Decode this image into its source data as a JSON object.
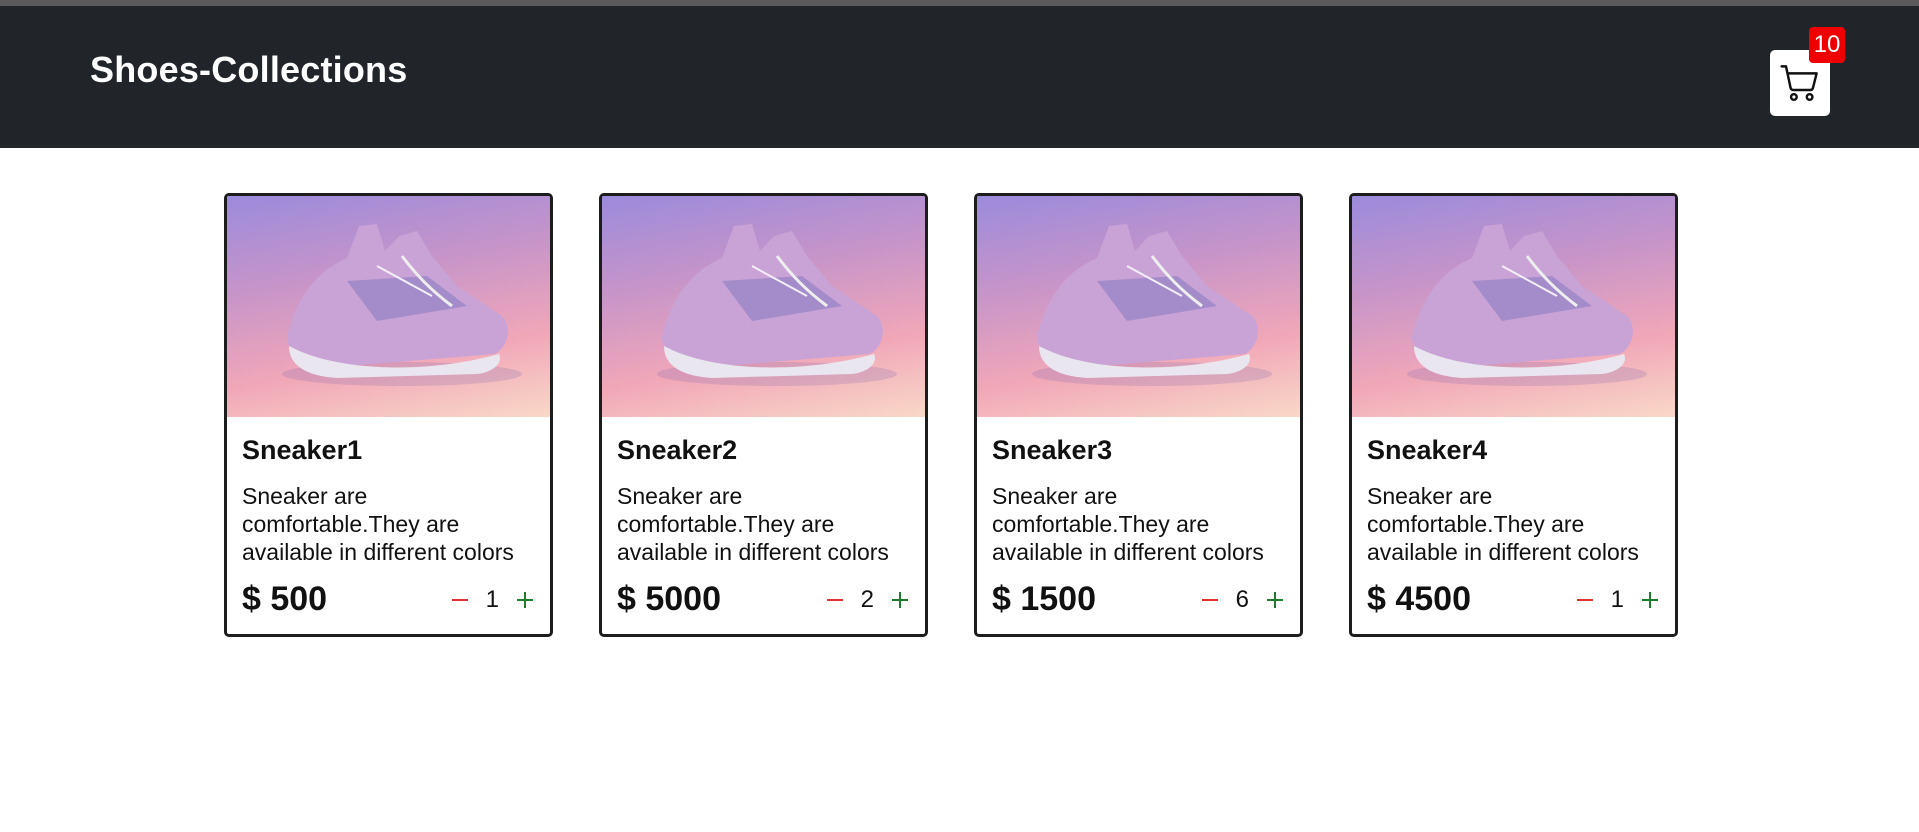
{
  "header": {
    "brand": "Shoes-Collections",
    "cart_icon": "shopping-cart-icon",
    "cart_count": "10",
    "badge_color": "#ee0000"
  },
  "products": [
    {
      "name": "Sneaker1",
      "description": "Sneaker are comfortable.They are available in different colors",
      "price": "$ 500",
      "quantity": "1"
    },
    {
      "name": "Sneaker2",
      "description": "Sneaker are comfortable.They are available in different colors",
      "price": "$ 5000",
      "quantity": "2"
    },
    {
      "name": "Sneaker3",
      "description": "Sneaker are comfortable.They are available in different colors",
      "price": "$ 1500",
      "quantity": "6"
    },
    {
      "name": "Sneaker4",
      "description": "Sneaker are comfortable.They are available in different colors",
      "price": "$ 4500",
      "quantity": "1"
    }
  ],
  "controls": {
    "decrement_icon": "minus-icon",
    "increment_icon": "plus-icon",
    "decrement_color": "#e03030",
    "increment_color": "#1c7c2c"
  }
}
